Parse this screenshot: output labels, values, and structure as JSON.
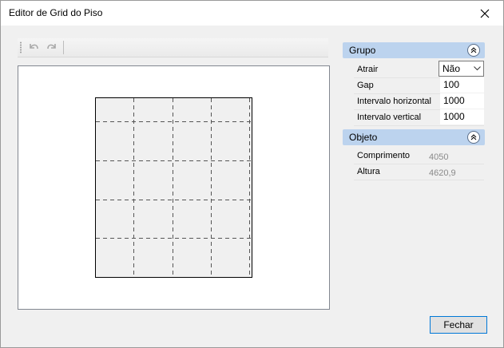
{
  "window": {
    "title": "Editor de Grid do Piso"
  },
  "toolbar": {
    "undo_icon": "undo-icon",
    "redo_icon": "redo-icon"
  },
  "groups": {
    "grupo": {
      "title": "Grupo",
      "rows": [
        {
          "label": "Atrair",
          "value": "Não",
          "type": "select"
        },
        {
          "label": "Gap",
          "value": "100"
        },
        {
          "label": "Intervalo horizontal",
          "value": "1000"
        },
        {
          "label": "Intervalo vertical",
          "value": "1000"
        }
      ]
    },
    "objeto": {
      "title": "Objeto",
      "rows": [
        {
          "label": "Comprimento",
          "value": "4050"
        },
        {
          "label": "Altura",
          "value": "4620,9"
        }
      ]
    }
  },
  "footer": {
    "close_label": "Fechar"
  }
}
